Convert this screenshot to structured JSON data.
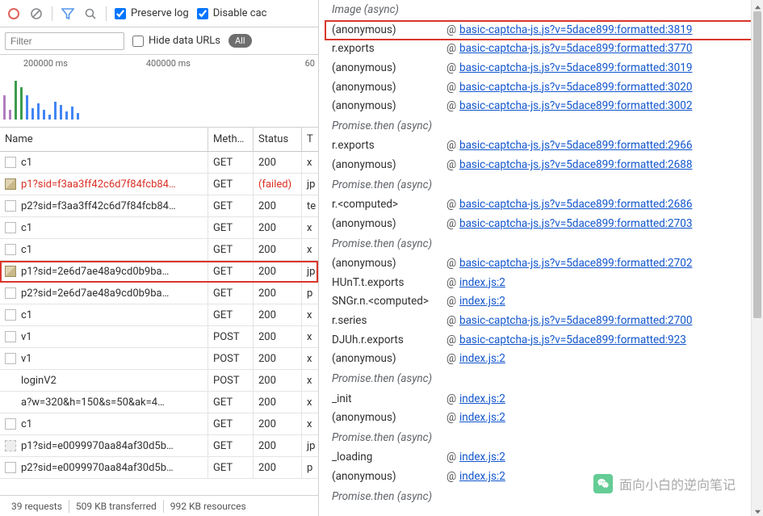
{
  "toolbar": {
    "preserve_label": "Preserve log",
    "disable_cache_label": "Disable cac"
  },
  "filterbar": {
    "filter_placeholder": "Filter",
    "hide_data_urls_label": "Hide data URLs",
    "all_label": "All"
  },
  "overview": {
    "tick1": "200000 ms",
    "tick2": "400000 ms",
    "tick3": "60"
  },
  "columns": {
    "name": "Name",
    "method": "Meth…",
    "status": "Status",
    "type": "T"
  },
  "requests": [
    {
      "name": "c1",
      "method": "GET",
      "status": "200",
      "type": "x",
      "icon": "doc"
    },
    {
      "name": "p1?sid=f3aa3ff42c6d7f84fcb84…",
      "method": "GET",
      "status": "(failed)",
      "type": "jp",
      "icon": "img",
      "failed": true
    },
    {
      "name": "p2?sid=f3aa3ff42c6d7f84fcb84…",
      "method": "GET",
      "status": "200",
      "type": "te",
      "icon": "doc"
    },
    {
      "name": "c1",
      "method": "GET",
      "status": "200",
      "type": "x",
      "icon": "doc"
    },
    {
      "name": "c1",
      "method": "GET",
      "status": "200",
      "type": "x",
      "icon": "doc"
    },
    {
      "name": "p1?sid=2e6d7ae48a9cd0b9ba…",
      "method": "GET",
      "status": "200",
      "type": "jp",
      "icon": "img",
      "highlight": true
    },
    {
      "name": "p2?sid=2e6d7ae48a9cd0b9ba…",
      "method": "GET",
      "status": "200",
      "type": "p",
      "icon": "doc"
    },
    {
      "name": "c1",
      "method": "GET",
      "status": "200",
      "type": "x",
      "icon": "doc"
    },
    {
      "name": "v1",
      "method": "POST",
      "status": "200",
      "type": "x",
      "icon": "doc"
    },
    {
      "name": "v1",
      "method": "POST",
      "status": "200",
      "type": "x",
      "icon": "doc"
    },
    {
      "name": "loginV2",
      "method": "POST",
      "status": "200",
      "type": "x",
      "icon": "none"
    },
    {
      "name": "a?w=320&h=150&s=50&ak=4…",
      "method": "GET",
      "status": "200",
      "type": "x",
      "icon": "none"
    },
    {
      "name": "c1",
      "method": "GET",
      "status": "200",
      "type": "x",
      "icon": "doc"
    },
    {
      "name": "p1?sid=e0099970aa84af30d5b…",
      "method": "GET",
      "status": "200",
      "type": "jp",
      "icon": "gray"
    },
    {
      "name": "p2?sid=e0099970aa84af30d5b…",
      "method": "GET",
      "status": "200",
      "type": "p",
      "icon": "doc"
    }
  ],
  "statusbar": {
    "requests": "39 requests",
    "transferred": "509 KB transferred",
    "resources": "992 KB resources"
  },
  "stack": [
    {
      "hdr": "Image (async)"
    },
    {
      "fn": "(anonymous)",
      "loc": "basic-captcha-js.js?v=5dace899:formatted:3819",
      "highlight": true
    },
    {
      "fn": "r.exports",
      "loc": "basic-captcha-js.js?v=5dace899:formatted:3770"
    },
    {
      "fn": "(anonymous)",
      "loc": "basic-captcha-js.js?v=5dace899:formatted:3019"
    },
    {
      "fn": "(anonymous)",
      "loc": "basic-captcha-js.js?v=5dace899:formatted:3020"
    },
    {
      "fn": "(anonymous)",
      "loc": "basic-captcha-js.js?v=5dace899:formatted:3002"
    },
    {
      "hdr": "Promise.then (async)"
    },
    {
      "fn": "r.exports",
      "loc": "basic-captcha-js.js?v=5dace899:formatted:2966"
    },
    {
      "fn": "(anonymous)",
      "loc": "basic-captcha-js.js?v=5dace899:formatted:2688"
    },
    {
      "hdr": "Promise.then (async)"
    },
    {
      "fn": "r.<computed>",
      "loc": "basic-captcha-js.js?v=5dace899:formatted:2686"
    },
    {
      "fn": "(anonymous)",
      "loc": "basic-captcha-js.js?v=5dace899:formatted:2703"
    },
    {
      "hdr": "Promise.then (async)"
    },
    {
      "fn": "(anonymous)",
      "loc": "basic-captcha-js.js?v=5dace899:formatted:2702"
    },
    {
      "fn": "HUnT.t.exports",
      "loc": "index.js:2"
    },
    {
      "fn": "SNGr.n.<computed>",
      "loc": "index.js:2"
    },
    {
      "fn": "r.series",
      "loc": "basic-captcha-js.js?v=5dace899:formatted:2700"
    },
    {
      "fn": "DJUh.r.exports",
      "loc": "basic-captcha-js.js?v=5dace899:formatted:923"
    },
    {
      "fn": "(anonymous)",
      "loc": "index.js:2"
    },
    {
      "hdr": "Promise.then (async)"
    },
    {
      "fn": "_init",
      "loc": "index.js:2"
    },
    {
      "fn": "(anonymous)",
      "loc": "index.js:2"
    },
    {
      "hdr": "Promise.then (async)"
    },
    {
      "fn": "_loading",
      "loc": "index.js:2"
    },
    {
      "fn": "(anonymous)",
      "loc": "index.js:2"
    },
    {
      "hdr": "Promise.then (async)"
    }
  ],
  "watermark": {
    "text": "面向小白的逆向笔记"
  }
}
